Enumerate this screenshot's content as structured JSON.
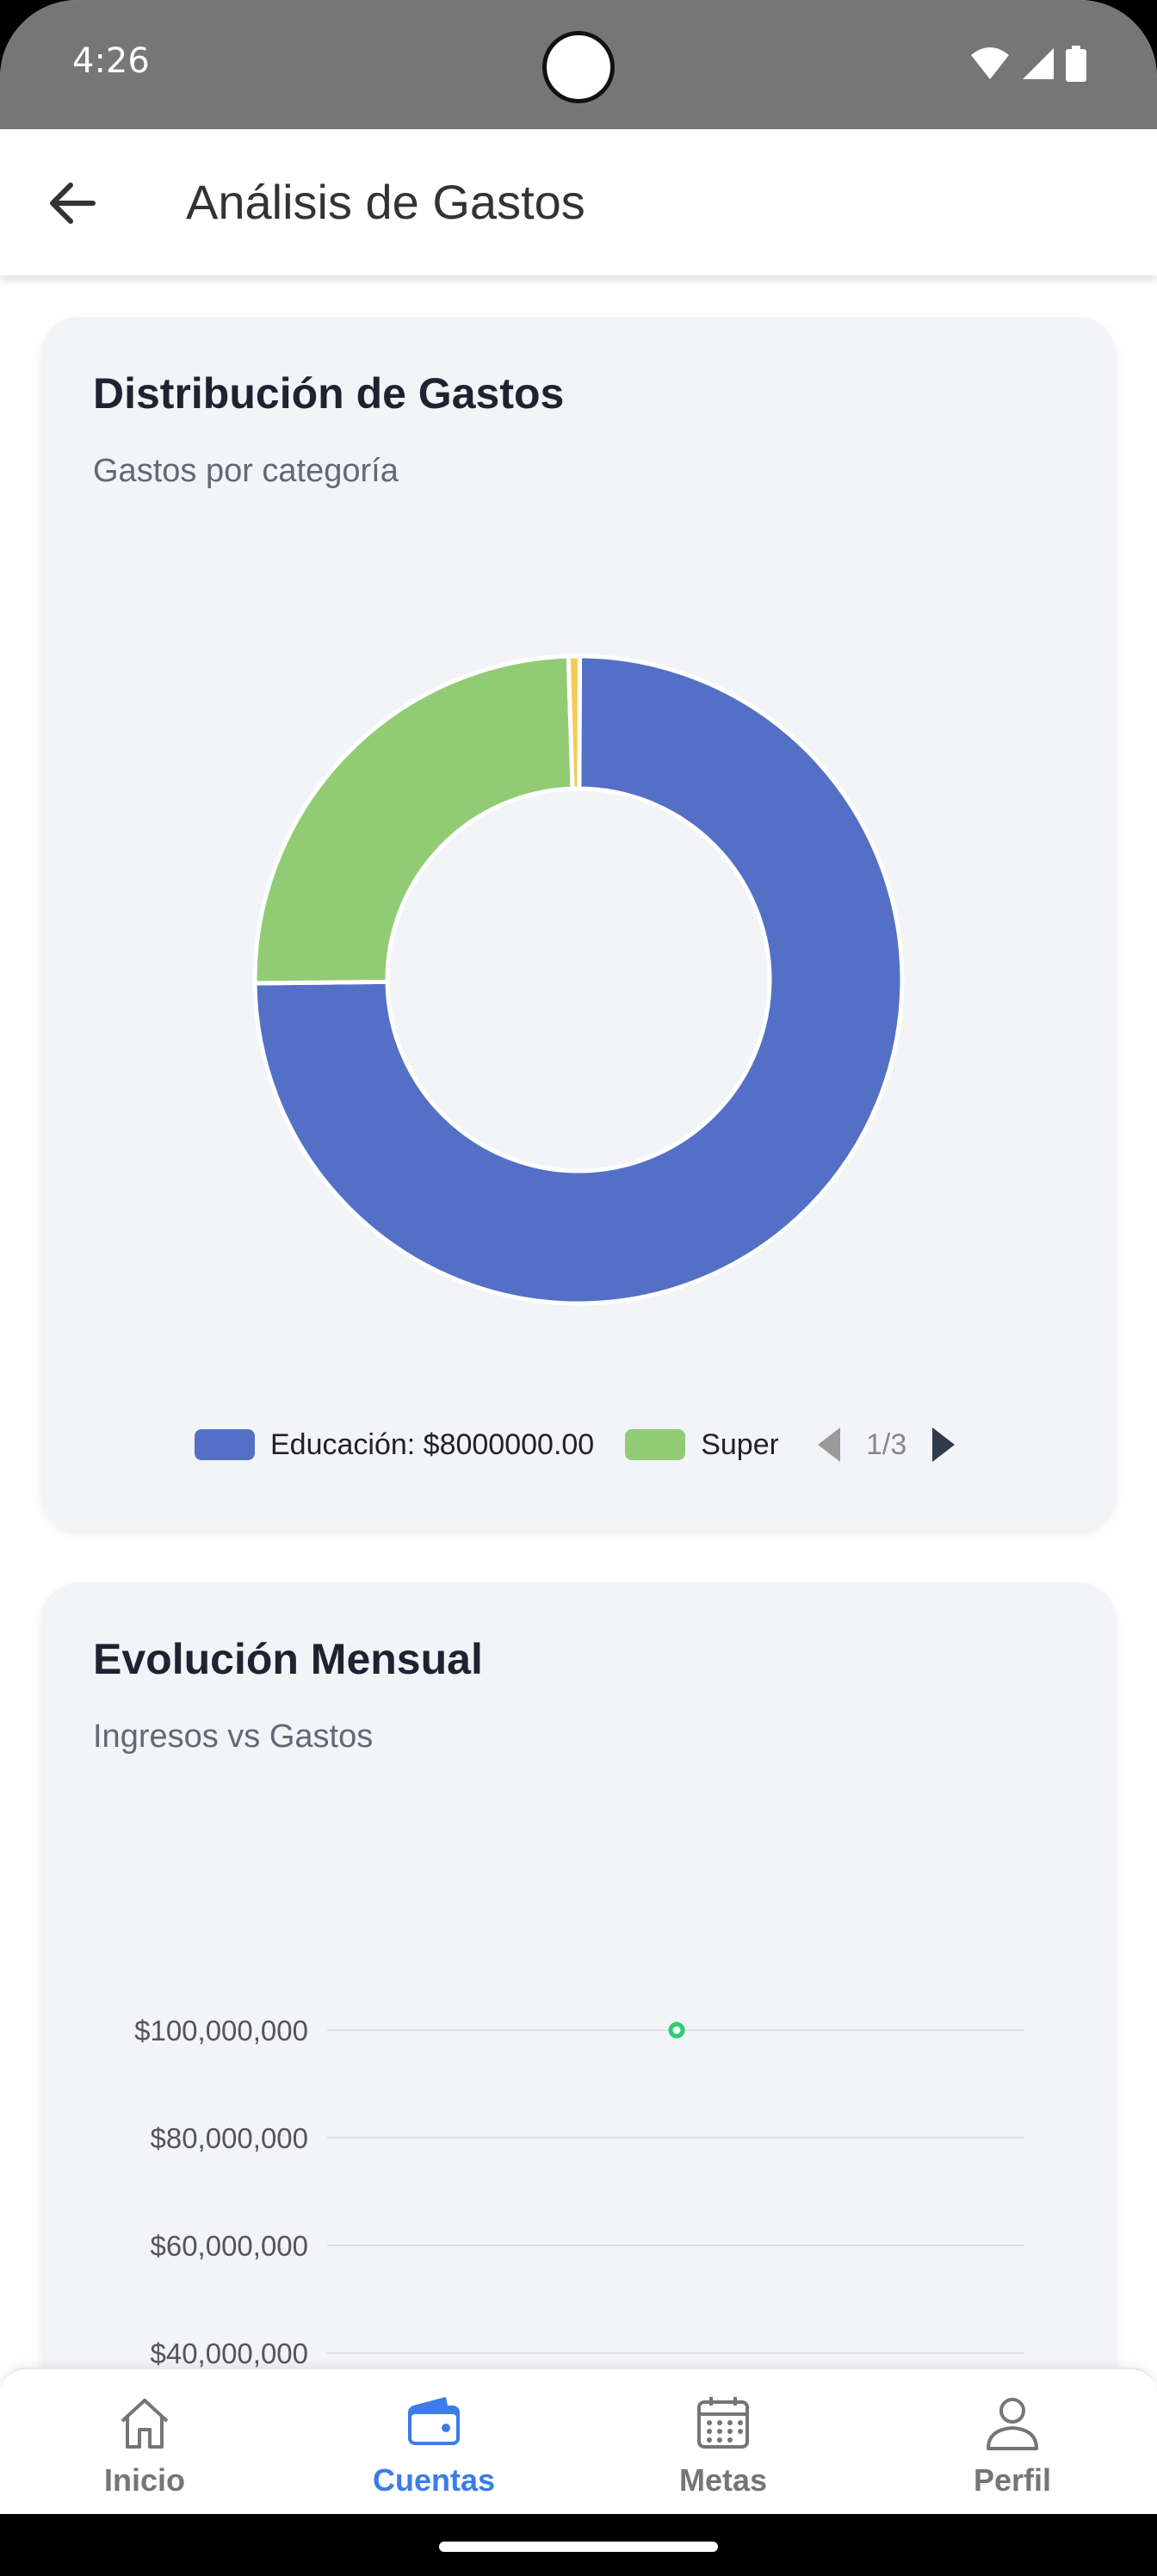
{
  "status_bar": {
    "time": "4:26"
  },
  "app_bar": {
    "title": "Análisis de Gastos"
  },
  "distribution_card": {
    "title": "Distribución de Gastos",
    "subtitle": "Gastos por categoría",
    "legend": [
      {
        "label": "Educación: $8000000.00",
        "color": "#5470c6"
      },
      {
        "label": "Super",
        "color": "#91cc75"
      }
    ],
    "pager": "1/3",
    "chart_data": {
      "type": "pie",
      "donut": true,
      "slices": [
        {
          "name": "Educación",
          "value": 8000000.0,
          "color": "#5470c6"
        },
        {
          "name": "Super",
          "value": 2640000,
          "color": "#91cc75"
        },
        {
          "name": "",
          "value": 60000,
          "color": "#fac858"
        }
      ]
    }
  },
  "evolution_card": {
    "title": "Evolución Mensual",
    "subtitle": "Ingresos vs Gastos",
    "chart_data": {
      "type": "line",
      "y_ticks": [
        "$100,000,000",
        "$80,000,000",
        "$60,000,000",
        "$40,000,000"
      ],
      "y_tick_values": [
        100000000,
        80000000,
        60000000,
        40000000
      ],
      "series": [
        {
          "name": "",
          "color": "#2ecc71",
          "points": [
            100000000
          ]
        }
      ],
      "grid": true
    }
  },
  "bottom_nav": {
    "items": [
      {
        "label": "Inicio",
        "icon": "home-icon",
        "active": false
      },
      {
        "label": "Cuentas",
        "icon": "wallet-icon",
        "active": true
      },
      {
        "label": "Metas",
        "icon": "calendar-icon",
        "active": false
      },
      {
        "label": "Perfil",
        "icon": "person-icon",
        "active": false
      }
    ],
    "active_color": "#3b7ce8",
    "inactive_color": "#757575"
  }
}
